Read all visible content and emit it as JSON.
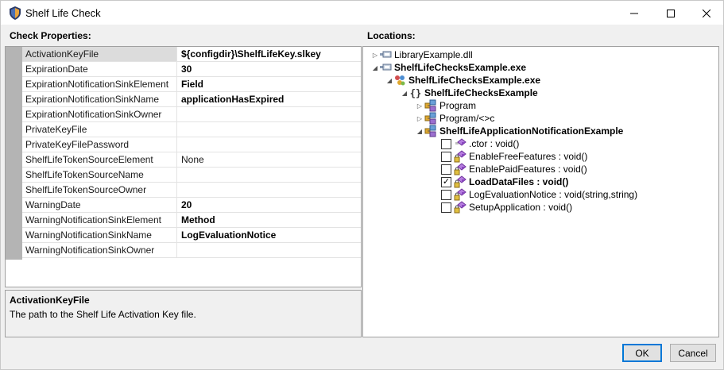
{
  "window": {
    "title": "Shelf Life Check"
  },
  "panels": {
    "check_properties_label": "Check Properties:",
    "locations_label": "Locations:"
  },
  "properties": [
    {
      "name": "ActivationKeyFile",
      "value": "${configdir}\\ShelfLifeKey.slkey",
      "bold": true,
      "selected": true
    },
    {
      "name": "ExpirationDate",
      "value": "30",
      "bold": true
    },
    {
      "name": "ExpirationNotificationSinkElement",
      "value": "Field",
      "bold": true
    },
    {
      "name": "ExpirationNotificationSinkName",
      "value": "applicationHasExpired",
      "bold": true
    },
    {
      "name": "ExpirationNotificationSinkOwner",
      "value": ""
    },
    {
      "name": "PrivateKeyFile",
      "value": ""
    },
    {
      "name": "PrivateKeyFilePassword",
      "value": ""
    },
    {
      "name": "ShelfLifeTokenSourceElement",
      "value": "None"
    },
    {
      "name": "ShelfLifeTokenSourceName",
      "value": ""
    },
    {
      "name": "ShelfLifeTokenSourceOwner",
      "value": ""
    },
    {
      "name": "WarningDate",
      "value": "20",
      "bold": true
    },
    {
      "name": "WarningNotificationSinkElement",
      "value": "Method",
      "bold": true
    },
    {
      "name": "WarningNotificationSinkName",
      "value": "LogEvaluationNotice",
      "bold": true
    },
    {
      "name": "WarningNotificationSinkOwner",
      "value": ""
    }
  ],
  "description": {
    "title": "ActivationKeyFile",
    "text": "The path to the Shelf Life Activation Key file."
  },
  "tree": [
    {
      "label": "LibraryExample.dll",
      "icon": "assembly-icon",
      "toggle": "collapsed"
    },
    {
      "label": "ShelfLifeChecksExample.exe",
      "icon": "assembly-icon",
      "toggle": "expanded",
      "bold": true
    },
    {
      "label": "ShelfLifeChecksExample.exe",
      "icon": "module-icon",
      "toggle": "expanded",
      "bold": true
    },
    {
      "label": "ShelfLifeChecksExample",
      "icon": "namespace-icon",
      "toggle": "expanded",
      "bold": true
    },
    {
      "label": "Program",
      "icon": "class-icon",
      "toggle": "collapsed"
    },
    {
      "label": "Program/<>c",
      "icon": "class-icon",
      "toggle": "collapsed"
    },
    {
      "label": "ShelfLifeApplicationNotificationExample",
      "icon": "class-icon",
      "toggle": "expanded",
      "bold": true
    },
    {
      "label": ".ctor : void()",
      "icon": "method-icon",
      "checked": false
    },
    {
      "label": "EnableFreeFeatures : void()",
      "icon": "private-method-icon",
      "checked": false
    },
    {
      "label": "EnablePaidFeatures : void()",
      "icon": "private-method-icon",
      "checked": false
    },
    {
      "label": "LoadDataFiles : void()",
      "icon": "private-method-icon",
      "checked": true,
      "bold": true
    },
    {
      "label": "LogEvaluationNotice : void(string,string)",
      "icon": "private-method-icon",
      "checked": false
    },
    {
      "label": "SetupApplication : void()",
      "icon": "private-method-icon",
      "checked": false
    }
  ],
  "buttons": {
    "ok": "OK",
    "cancel": "Cancel"
  }
}
